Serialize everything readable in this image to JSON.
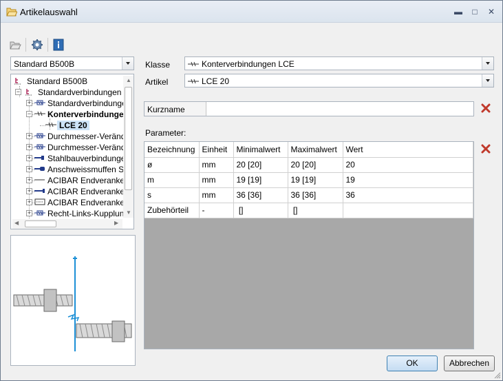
{
  "window": {
    "title": "Artikelauswahl",
    "controls": {
      "minimize": "▬",
      "maximize": "□",
      "close": "✕"
    }
  },
  "toolbar": {
    "icons": [
      "folder-open-icon",
      "gear-icon",
      "info-icon"
    ]
  },
  "left": {
    "standard_select": "Standard B500B",
    "tree": [
      {
        "label": "Standard B500B",
        "level": 0,
        "icon": "rebar-standard-icon",
        "expander": ""
      },
      {
        "label": "Standardverbindungen",
        "level": 1,
        "icon": "rebar-standard-icon",
        "expander": "−"
      },
      {
        "label": "Standardverbindungen",
        "level": 2,
        "icon": "coupler-box-icon",
        "expander": "+"
      },
      {
        "label": "Konterverbindungen",
        "level": 2,
        "icon": "coupler-line-icon",
        "expander": "−",
        "bold": true
      },
      {
        "label": "LCE 20",
        "level": 3,
        "icon": "coupler-line-icon",
        "expander": "",
        "selected": true,
        "bold": true
      },
      {
        "label": "Durchmesser-Veränd",
        "level": 2,
        "icon": "coupler-box-icon",
        "expander": "+"
      },
      {
        "label": "Durchmesser-Veränd",
        "level": 2,
        "icon": "coupler-box-icon",
        "expander": "+"
      },
      {
        "label": "Stahlbauverbindunge",
        "level": 2,
        "icon": "coupler-weld-icon",
        "expander": "+"
      },
      {
        "label": "Anschweissmuffen S",
        "level": 2,
        "icon": "coupler-sleeve-icon",
        "expander": "+"
      },
      {
        "label": "ACIBAR Endveranke",
        "level": 2,
        "icon": "anchor-line-icon",
        "expander": "+"
      },
      {
        "label": "ACIBAR Endveranke",
        "level": 2,
        "icon": "anchor-head-icon",
        "expander": "+"
      },
      {
        "label": "ACIBAR Endveranke",
        "level": 2,
        "icon": "anchor-plate-icon",
        "expander": "+"
      },
      {
        "label": "Recht-Links-Kupplun",
        "level": 2,
        "icon": "coupler-box-icon",
        "expander": "+"
      }
    ]
  },
  "right": {
    "klasse_label": "Klasse",
    "klasse_value": "Konterverbindungen LCE",
    "artikel_label": "Artikel",
    "artikel_value": "LCE 20",
    "kurzname_label": "Kurzname",
    "kurzname_value": "",
    "parameter_label": "Parameter:",
    "columns": [
      "Bezeichnung",
      "Einheit",
      "Minimalwert",
      "Maximalwert",
      "Wert"
    ],
    "rows": [
      [
        "ø",
        "mm",
        "20 [20]",
        "20 [20]",
        "20"
      ],
      [
        "m",
        "mm",
        "19 [19]",
        "19 [19]",
        "19"
      ],
      [
        "s",
        "mm",
        "36 [36]",
        "36 [36]",
        "36"
      ],
      [
        "Zubehörteil",
        "-",
        " []",
        " []",
        ""
      ]
    ]
  },
  "buttons": {
    "ok": "OK",
    "cancel": "Abbrechen"
  },
  "colors": {
    "accent": "#3c7fb1",
    "delete": "#c0392b",
    "grid_bg": "#a8a8a8",
    "selection": "#cde3f7"
  }
}
